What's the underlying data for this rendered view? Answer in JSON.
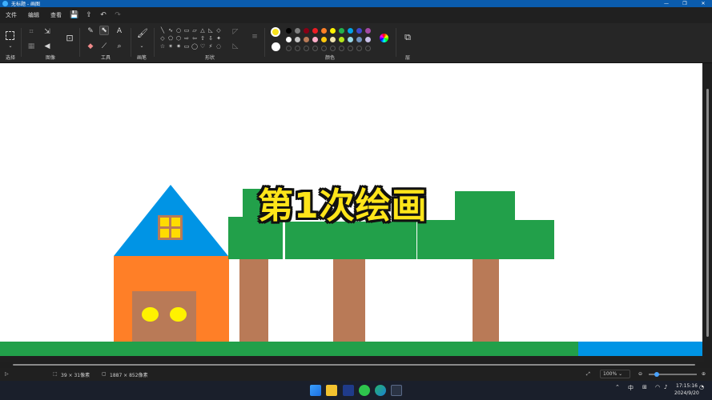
{
  "window": {
    "title": "无标题 - 画图",
    "controls": {
      "minimize": "—",
      "maximize": "❐",
      "close": "✕"
    }
  },
  "menu": {
    "items": [
      "文件",
      "编辑",
      "查看"
    ],
    "quick_access": {
      "save": "💾",
      "share": "⇪",
      "undo": "↶",
      "redo": "↷"
    }
  },
  "ribbon": {
    "groups": {
      "select": "选择",
      "image": "图像",
      "tools": "工具",
      "brushes": "画笔",
      "shapes": "形状",
      "colors": "颜色",
      "layers": "层"
    },
    "shape_glyphs": [
      "╲",
      "∿",
      "○",
      "▭",
      "▱",
      "△",
      "◺",
      "◇",
      "◇",
      "⬠",
      "⬡",
      "⇨",
      "⇦",
      "⇧",
      "⇩",
      "✦",
      "☆",
      "✶",
      "✷",
      "▭",
      "◯",
      "♡",
      "⚡",
      "◌"
    ],
    "colors": {
      "primary": "#f7e21b",
      "secondary": "#ffffff",
      "palette_row1": [
        "#000000",
        "#7f7f7f",
        "#880015",
        "#ed1c24",
        "#ff7f27",
        "#fff200",
        "#22b14c",
        "#00a2e8",
        "#3f48cc",
        "#a349a4"
      ],
      "palette_row2": [
        "#ffffff",
        "#c3c3c3",
        "#b97a57",
        "#ffaec9",
        "#ffc90e",
        "#efe4b0",
        "#b5e61d",
        "#99d9ea",
        "#7092be",
        "#c8bfe7"
      ]
    }
  },
  "canvas": {
    "overlay_text": "第1次绘画",
    "colors": {
      "roof": "#0094e5",
      "house": "#ff7f27",
      "door": "#b97a57",
      "window_frame": "#b97a57",
      "window_fill": "#ffdc00",
      "knob": "#fff200",
      "tree_leaves": "#22a04a",
      "trunk": "#b97a57",
      "grass": "#22a04a",
      "water": "#0094e5"
    }
  },
  "status": {
    "cursor": "▷",
    "selection_size": "39 × 31像素",
    "canvas_size": "1887 × 852像素",
    "zoom": "100%"
  },
  "taskbar": {
    "ime": "中",
    "time": "17:15:16",
    "date": "2024/9/20"
  }
}
